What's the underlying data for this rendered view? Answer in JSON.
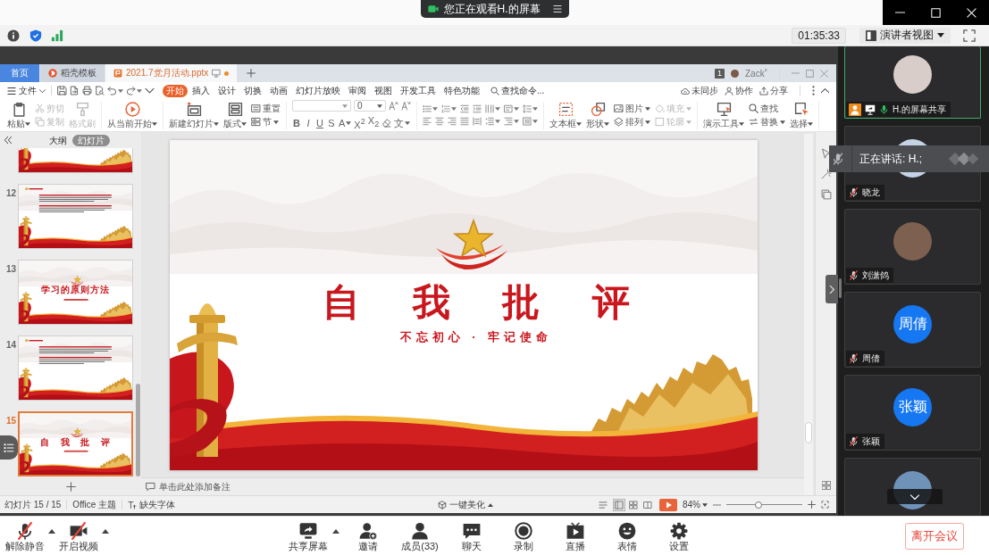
{
  "viewing_banner": {
    "text": "您正在观看H.的屏幕"
  },
  "meeting_bar": {
    "timer": "01:35:33",
    "view_mode": "演讲者视图"
  },
  "presentation_app": {
    "tabs": [
      {
        "label": "首页",
        "kind": "home",
        "selected": false,
        "unsaved": false
      },
      {
        "label": "稻壳模板",
        "kind": "page",
        "selected": false,
        "unsaved": false
      },
      {
        "label": "2021.7党月活动.pptx",
        "kind": "page",
        "selected": true,
        "unsaved": true
      }
    ],
    "account": {
      "badge": "1",
      "user": "Zack˚"
    },
    "file_menu": "文件",
    "ribbon_tabs": [
      {
        "label": "开始",
        "selected": true
      },
      {
        "label": "插入",
        "selected": false
      },
      {
        "label": "设计",
        "selected": false
      },
      {
        "label": "切换",
        "selected": false
      },
      {
        "label": "动画",
        "selected": false
      },
      {
        "label": "幻灯片放映",
        "selected": false
      },
      {
        "label": "审阅",
        "selected": false
      },
      {
        "label": "视图",
        "selected": false
      },
      {
        "label": "开发工具",
        "selected": false
      },
      {
        "label": "特色功能",
        "selected": false
      }
    ],
    "command_search": {
      "placeholder": "查找命令..."
    },
    "actions": [
      "未同步",
      "协作",
      "分享"
    ],
    "ribbon": [
      [
        {
          "kind": "large",
          "label": "粘贴",
          "dropdown": true,
          "disabled": false
        },
        {
          "kind": "stack",
          "items": [
            {
              "label": "剪切",
              "dropdown": false,
              "disabled": true
            },
            {
              "label": "复制",
              "dropdown": false,
              "disabled": true
            }
          ]
        },
        {
          "kind": "large",
          "label": "格式刷",
          "dropdown": false,
          "disabled": true
        }
      ],
      [
        {
          "kind": "large",
          "label": "从当前开始",
          "dropdown": true,
          "disabled": false
        }
      ],
      [
        {
          "kind": "large",
          "label": "新建幻灯片",
          "dropdown": true,
          "disabled": false
        },
        {
          "kind": "large",
          "label": "版式",
          "dropdown": true,
          "disabled": false
        },
        {
          "kind": "stack",
          "items": [
            {
              "label": "重置",
              "dropdown": false,
              "disabled": false
            },
            {
              "label": "节",
              "dropdown": true,
              "disabled": false
            }
          ]
        }
      ],
      [
        {
          "kind": "font",
          "font_size": "0",
          "buttons": [
            {
              "kind": "text",
              "label": "B",
              "dropdown": false
            },
            {
              "kind": "text",
              "label": "I",
              "dropdown": false
            },
            {
              "kind": "text",
              "label": "U",
              "dropdown": false
            },
            {
              "kind": "text",
              "label": "S",
              "dropdown": false
            },
            {
              "kind": "text",
              "label": "A",
              "dropdown": true
            },
            {
              "kind": "text",
              "label": "X$^{2}$",
              "dropdown": false
            },
            {
              "kind": "text",
              "label": "X$_{2}$",
              "dropdown": false
            },
            {
              "kind": "icon",
              "dropdown": false
            },
            {
              "kind": "text",
              "label": "文",
              "dropdown": true
            }
          ]
        }
      ],
      [
        {
          "kind": "paragraph",
          "rows": [
            [
              {
                "dropdown": true
              },
              {
                "dropdown": true
              },
              {
                "dropdown": false
              },
              {
                "dropdown": false
              },
              {
                "dropdown": true
              },
              {
                "dropdown": true
              },
              {
                "dropdown": true
              }
            ],
            [
              {
                "dropdown": false
              },
              {
                "dropdown": false
              },
              {
                "dropdown": false
              },
              {
                "dropdown": false
              },
              {
                "dropdown": false
              },
              {
                "dropdown": true
              },
              {
                "dropdown": true
              },
              {
                "dropdown": true
              }
            ]
          ]
        }
      ],
      [
        {
          "kind": "large",
          "label": "文本框",
          "dropdown": true,
          "disabled": false
        },
        {
          "kind": "large",
          "label": "形状",
          "dropdown": true,
          "disabled": false
        },
        {
          "kind": "stack",
          "items": [
            {
              "label": "图片",
              "dropdown": true,
              "disabled": false
            },
            {
              "label": "排列",
              "dropdown": true,
              "disabled": false
            }
          ]
        },
        {
          "kind": "stack",
          "items": [
            {
              "label": "填充",
              "dropdown": true,
              "disabled": true
            },
            {
              "label": "轮廓",
              "dropdown": true,
              "disabled": true
            }
          ]
        }
      ],
      [
        {
          "kind": "large",
          "label": "演示工具",
          "dropdown": true,
          "disabled": false
        },
        {
          "kind": "stack",
          "items": [
            {
              "label": "查找",
              "dropdown": false,
              "disabled": false
            },
            {
              "label": "替换",
              "dropdown": true,
              "disabled": false
            }
          ]
        },
        {
          "kind": "large",
          "label": "选择",
          "dropdown": true,
          "disabled": false
        }
      ]
    ],
    "slide_panel": {
      "tabs": [
        {
          "label": "大纲",
          "selected": false
        },
        {
          "label": "幻灯片",
          "selected": true
        }
      ],
      "slides": [
        {
          "kind": "content",
          "clipped": true,
          "selected": false
        },
        {
          "number": "12",
          "kind": "content",
          "clipped": false,
          "selected": false
        },
        {
          "number": "13",
          "kind": "title",
          "title": "学习的原则方法",
          "clipped": false,
          "selected": false
        },
        {
          "number": "14",
          "kind": "content",
          "clipped": false,
          "selected": false
        },
        {
          "number": "15",
          "kind": "title",
          "title": "自 我 批 评",
          "clipped": false,
          "selected": true
        }
      ]
    },
    "slide": {
      "title": "自 我 批 评",
      "subtitle": "不忘初心 · 牢记使命"
    },
    "notes_prompt": "单击此处添加备注",
    "status_bar": {
      "slide_count": "幻灯片 15 / 15",
      "theme": "Office 主题",
      "missing_fonts": "缺失字体",
      "beautify": "一键美化",
      "views": [
        {
          "selected": true
        },
        {
          "selected": false
        },
        {
          "selected": false
        }
      ],
      "zoom": "84%",
      "zoom_slider": {
        "level": 0.42
      }
    }
  },
  "speaker_banner": {
    "text": "正在讲话: H.;"
  },
  "participants": [
    {
      "name": "H.的屏幕共享",
      "kind": "photo",
      "host": true,
      "sharing": true,
      "muted": false,
      "active": true
    },
    {
      "name": "晓龙",
      "kind": "photo",
      "host": false,
      "sharing": false,
      "muted": true,
      "active": false
    },
    {
      "name": "刘潇鸽",
      "kind": "photo",
      "host": false,
      "sharing": false,
      "muted": true,
      "active": false
    },
    {
      "name": "周倩",
      "kind": "initials",
      "avatar_text": "周倩",
      "host": false,
      "sharing": false,
      "muted": true,
      "active": false
    },
    {
      "name": "张颖",
      "kind": "initials",
      "avatar_text": "张颖",
      "host": false,
      "sharing": false,
      "muted": true,
      "active": false
    },
    {
      "kind": "photo",
      "active": false
    }
  ],
  "toolbar": {
    "audio": {
      "label": "解除静音",
      "muted": true,
      "menu": true
    },
    "video": {
      "label": "开启视频",
      "off": true,
      "menu": true
    },
    "items": [
      {
        "label": "共享屏幕",
        "menu": true
      },
      {
        "label": "邀请",
        "menu": false
      },
      {
        "label": "成员(33)",
        "menu": false
      },
      {
        "label": "聊天",
        "menu": false
      },
      {
        "label": "录制",
        "menu": false
      },
      {
        "label": "直播",
        "menu": false
      },
      {
        "label": "表情",
        "menu": false
      },
      {
        "label": "设置",
        "menu": false
      }
    ],
    "leave": "离开会议"
  }
}
